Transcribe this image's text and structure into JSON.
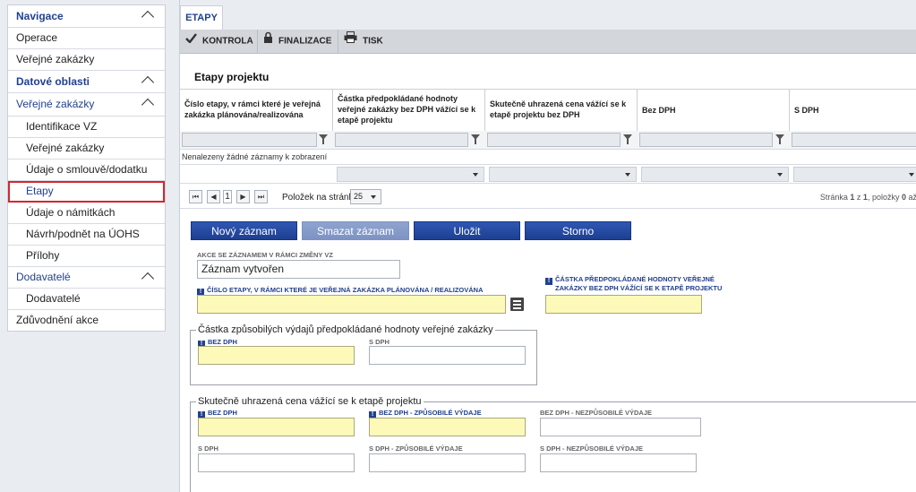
{
  "sidebar": {
    "navigace": "Navigace",
    "operace": "Operace",
    "verejne_zakazky_top": "Veřejné zakázky",
    "datove_oblasti": "Datové oblasti",
    "verejne_zakazky_group": "Veřejné zakázky",
    "identifikace_vz": "Identifikace VZ",
    "verejne_zakazky_sub": "Veřejné zakázky",
    "udaje_smlouve": "Údaje o smlouvě/dodatku",
    "etapy": "Etapy",
    "udaje_namitkach": "Údaje o námitkách",
    "navrh_podnet": "Návrh/podnět na ÚOHS",
    "prilohy": "Přílohy",
    "dodavatele_group": "Dodavatelé",
    "dodavatele_sub": "Dodavatelé",
    "zduvodneni": "Zdůvodnění akce"
  },
  "tab": {
    "label": "ETAPY"
  },
  "toolbar": {
    "kontrola": "KONTROLA",
    "finalizace": "FINALIZACE",
    "tisk": "TISK"
  },
  "grid": {
    "title": "Etapy projektu",
    "columns": [
      "Číslo etapy, v rámci které je veřejná zakázka plánována/realizována",
      "Částka předpokládané hodnoty veřejné zakázky bez DPH vážící se k etapě projektu",
      "Skutečně uhrazená cena vážící se k etapě projektu bez DPH",
      "Bez DPH",
      "S DPH"
    ],
    "empty_message": "Nenalezeny žádné záznamy k zobrazení"
  },
  "pager": {
    "first": "⏮",
    "prev": "◀",
    "page": "1",
    "next": "▶",
    "last": "⏭",
    "per_page_label": "Položek na stránku",
    "per_page_value": "25",
    "info_prefix": "Stránka ",
    "info_page": "1",
    "info_mid": " z ",
    "info_pages": "1",
    "info_items": ", položky ",
    "info_count": "0",
    "info_suffix": " až"
  },
  "actions": {
    "new": "Nový záznam",
    "delete": "Smazat záznam",
    "save": "Uložit",
    "cancel": "Storno"
  },
  "form": {
    "akce_label": "AKCE SE ZÁZNAMEM V RÁMCI ZMĚNY VZ",
    "akce_value": "Záznam vytvořen",
    "cislo_etapy_label": "ČÍSLO ETAPY, V RÁMCI KTERÉ JE VEŘEJNÁ ZAKÁZKA PLÁNOVÁNA / REALIZOVÁNA",
    "castka_label_1": "ČÁSTKA PŘEDPOKLÁDANÉ HODNOTY VEŘEJNÉ",
    "castka_label_2": "ZAKÁZKY BEZ DPH VÁŽÍCÍ SE K ETAPĚ PROJEKTU",
    "box1_legend": "Částka způsobilých výdajů předpokládané hodnoty veřejné zakázky",
    "box1_bez_dph": "BEZ DPH",
    "box1_s_dph": "S DPH",
    "box2_legend": "Skutečně uhrazená cena vážící se k etapě projektu",
    "box2_bez_dph": "BEZ DPH",
    "box2_bez_dph_zpusobile": "BEZ DPH - ZPŮSOBILÉ VÝDAJE",
    "box2_bez_dph_nezpusobile": "BEZ DPH - NEZPŮSOBILÉ VÝDAJE",
    "box2_s_dph": "S DPH",
    "box2_s_dph_zpusobile": "S DPH - ZPŮSOBILÉ VÝDAJE",
    "box2_s_dph_nezpusobile": "S DPH - NEZPŮSOBILÉ VÝDAJE",
    "req_mark": "!"
  },
  "colors": {
    "brand_blue": "#22408f",
    "required_yellow": "#fdfab9",
    "highlight_red": "#d7262d"
  }
}
